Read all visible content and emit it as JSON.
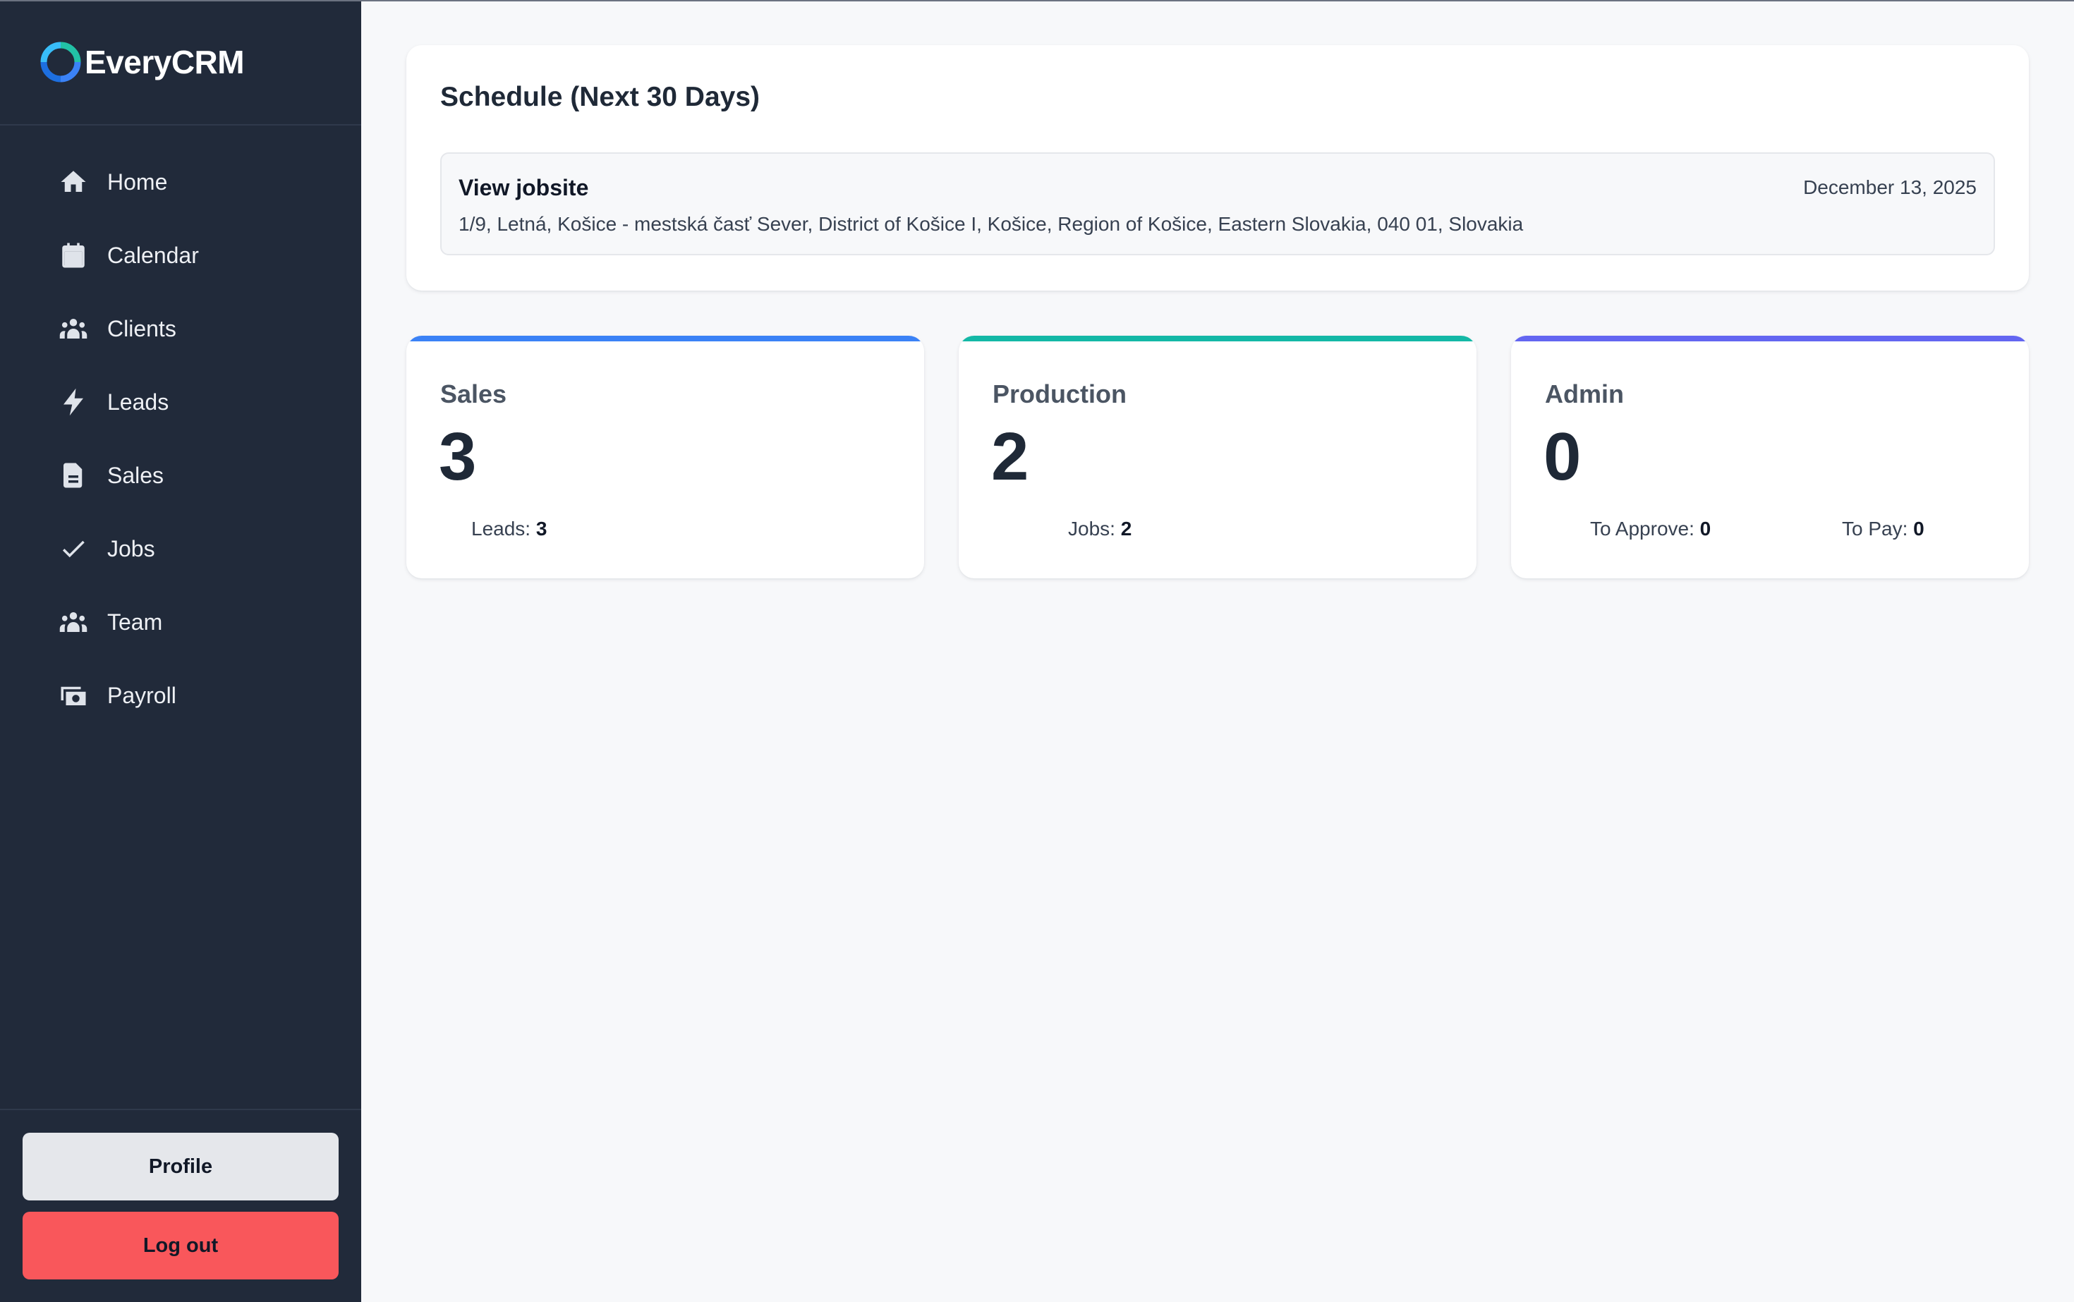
{
  "app": {
    "name": "EveryCRM"
  },
  "sidebar": {
    "items": [
      {
        "label": "Home",
        "icon": "home-icon"
      },
      {
        "label": "Calendar",
        "icon": "calendar-icon"
      },
      {
        "label": "Clients",
        "icon": "users-icon"
      },
      {
        "label": "Leads",
        "icon": "bolt-icon"
      },
      {
        "label": "Sales",
        "icon": "document-icon"
      },
      {
        "label": "Jobs",
        "icon": "check-icon"
      },
      {
        "label": "Team",
        "icon": "users-icon"
      },
      {
        "label": "Payroll",
        "icon": "money-icon"
      }
    ],
    "profile_label": "Profile",
    "logout_label": "Log out"
  },
  "schedule": {
    "title": "Schedule (Next 30 Days)",
    "items": [
      {
        "title": "View jobsite",
        "date": "December 13, 2025",
        "address": "1/9, Letná, Košice - mestská časť Sever, District of Košice I, Košice, Region of Košice, Eastern Slovakia, 040 01, Slovakia"
      }
    ]
  },
  "stats": {
    "sales": {
      "title": "Sales",
      "value": "3",
      "leads_label": "Leads:",
      "leads_value": "3",
      "accent": "#3b82f6"
    },
    "production": {
      "title": "Production",
      "value": "2",
      "jobs_label": "Jobs:",
      "jobs_value": "2",
      "accent": "#14b8a6"
    },
    "admin": {
      "title": "Admin",
      "value": "0",
      "approve_label": "To Approve:",
      "approve_value": "0",
      "pay_label": "To Pay:",
      "pay_value": "0",
      "accent": "#6366f1"
    }
  },
  "colors": {
    "sidebar_bg": "#212a3a",
    "logout_bg": "#f9575b",
    "profile_bg": "#e5e7eb",
    "page_bg": "#f7f8fa"
  }
}
